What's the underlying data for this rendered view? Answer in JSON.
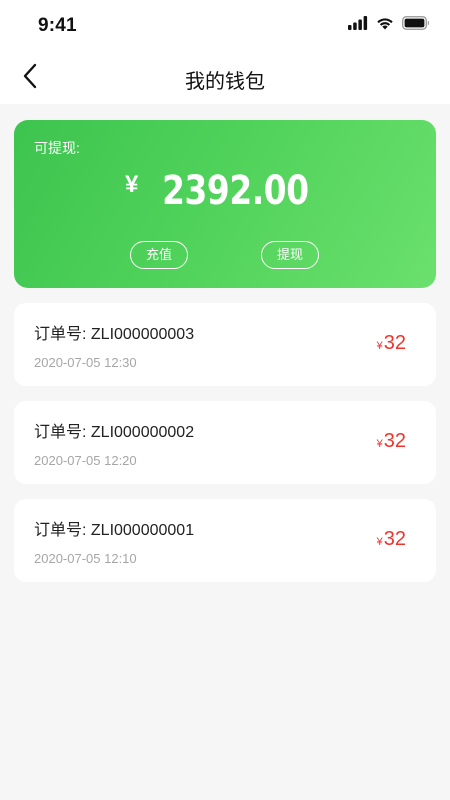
{
  "status_bar": {
    "time": "9:41",
    "icons": [
      "cellular-signal-icon",
      "wifi-icon",
      "battery-icon"
    ]
  },
  "header": {
    "title": "我的钱包",
    "back_icon": "chevron-left-icon"
  },
  "wallet": {
    "withdrawable_label": "可提现:",
    "currency_symbol": "¥",
    "balance": "2392.00",
    "recharge_label": "充值",
    "withdraw_label": "提现"
  },
  "orders": [
    {
      "label": "订单号: ZLI000000003",
      "time": "2020-07-05 12:30",
      "currency_symbol": "¥",
      "amount": "32"
    },
    {
      "label": "订单号: ZLI000000002",
      "time": "2020-07-05 12:20",
      "currency_symbol": "¥",
      "amount": "32"
    },
    {
      "label": "订单号: ZLI000000001",
      "time": "2020-07-05 12:10",
      "currency_symbol": "¥",
      "amount": "32"
    }
  ],
  "colors": {
    "card_gradient_start": "#3dc44f",
    "card_gradient_end": "#6be06d",
    "amount_red": "#f0332b",
    "background": "#f6f6f6"
  }
}
